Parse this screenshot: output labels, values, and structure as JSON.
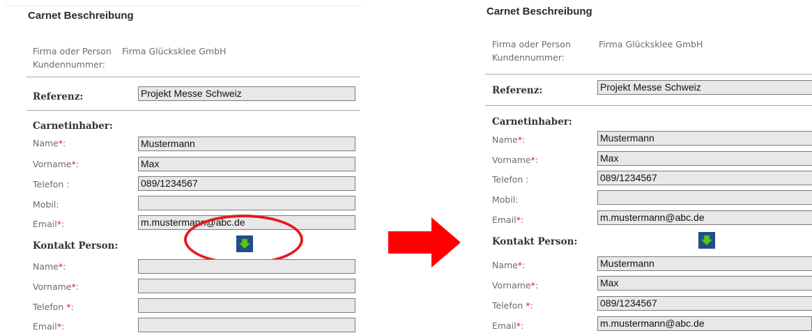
{
  "form": {
    "title": "Carnet Beschreibung",
    "firma_label_line1": "Firma oder Person",
    "firma_label_line2": "Kundennummer:",
    "firma_value": "Firma Glücksklee GmbH",
    "referenz_label": "Referenz:",
    "referenz_value": "Projekt Messe Schweiz",
    "carnetinhaber_title": "Carnetinhaber:",
    "kontakt_title": "Kontakt Person:",
    "required_mark": "*",
    "labels": {
      "name": "Name",
      "vorname": "Vorname",
      "telefon": "Telefon :",
      "telefon_req": "Telefon ",
      "telefon_req_suffix": ":",
      "mobil": "Mobil:",
      "email": "Email",
      "colon": ":"
    }
  },
  "before": {
    "inhaber": {
      "name": "Mustermann",
      "vorname": "Max",
      "telefon": "089/1234567",
      "mobil": "",
      "email": "m.mustermann@abc.de"
    },
    "kontakt": {
      "name": "",
      "vorname": "",
      "telefon": "",
      "email": ""
    }
  },
  "after": {
    "inhaber": {
      "name": "Mustermann",
      "vorname": "Max",
      "telefon": "089/1234567",
      "mobil": "",
      "email": "m.mustermann@abc.de"
    },
    "kontakt": {
      "name": "Mustermann",
      "vorname": "Max",
      "telefon": "089/1234567",
      "email": "m.mustermann@abc.de"
    }
  },
  "icons": {
    "copy_button": "arrow-down-icon",
    "transition": "right-arrow-icon",
    "highlight": "red-ellipse"
  },
  "colors": {
    "required": "#e8141b",
    "button_bg": "#1f4f8a",
    "arrow_green": "#5cc21f",
    "highlight_red": "#e31b23"
  }
}
